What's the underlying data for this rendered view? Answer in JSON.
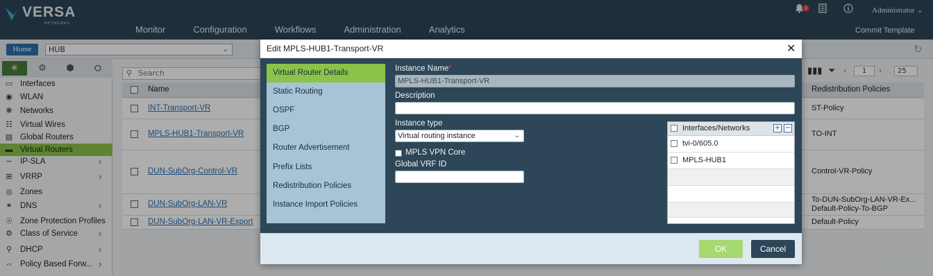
{
  "header": {
    "logo_text": "VERSA",
    "logo_sub": "NETWORKS",
    "nav": [
      "Monitor",
      "Configuration",
      "Workflows",
      "Administration",
      "Analytics"
    ],
    "alerts_badge": "0",
    "user": "Administrator",
    "commit_template": "Commit Template"
  },
  "subbar": {
    "home_label": "Home",
    "hub_value": "HUB"
  },
  "sidebar": {
    "items": [
      {
        "label": "Interfaces",
        "icon": "interfaces-icon"
      },
      {
        "label": "WLAN",
        "icon": "wlan-icon"
      },
      {
        "label": "Networks",
        "icon": "networks-icon"
      },
      {
        "label": "Virtual Wires",
        "icon": "virtual-wires-icon"
      },
      {
        "label": "Global Routers",
        "icon": "global-routers-icon"
      },
      {
        "label": "Virtual Routers",
        "icon": "virtual-routers-icon"
      },
      {
        "label": "IP-SLA",
        "icon": "ip-sla-icon"
      },
      {
        "label": "VRRP",
        "icon": "vrrp-icon"
      },
      {
        "label": "Zones",
        "icon": "zones-icon"
      },
      {
        "label": "DNS",
        "icon": "dns-icon"
      },
      {
        "label": "Zone Protection Profiles",
        "icon": "zone-protection-icon"
      },
      {
        "label": "Class of Service",
        "icon": "class-of-service-icon"
      },
      {
        "label": "DHCP",
        "icon": "dhcp-icon"
      },
      {
        "label": "Policy Based Forw...",
        "icon": "policy-forwarding-icon"
      }
    ]
  },
  "table": {
    "search_placeholder": "Search",
    "headers": {
      "name": "Name",
      "redistribution": "Redistribution Policies"
    },
    "rows": [
      {
        "name": "INT-Transport-VR",
        "redistribution": "ST-Policy"
      },
      {
        "name": "MPLS-HUB1-Transport-VR",
        "redistribution": "TO-INT"
      },
      {
        "name": "DUN-SubOrg-Control-VR",
        "redistribution": "Control-VR-Policy"
      },
      {
        "name": "DUN-SubOrg-LAN-VR",
        "redistribution": "To-DUN-SubOrg-LAN-VR-Ex...",
        "redistribution2": "Default-Policy-To-BGP"
      },
      {
        "name": "DUN-SubOrg-LAN-VR-Export",
        "redistribution": "Default-Policy"
      }
    ],
    "page": "1",
    "page_size": "25"
  },
  "modal": {
    "title": "Edit MPLS-HUB1-Transport-VR",
    "nav": [
      "Virtual Router Details",
      "Static Routing",
      "OSPF",
      "BGP",
      "Router Advertisement",
      "Prefix Lists",
      "Redistribution Policies",
      "Instance Import Policies"
    ],
    "instance_name_label": "Instance Name",
    "instance_name_value": "MPLS-HUB1-Transport-VR",
    "description_label": "Description",
    "instance_type_label": "Instance type",
    "instance_type_value": "Virtual routing instance",
    "mpls_vpn_core_label": "MPLS VPN Core",
    "global_vrf_label": "Global VRF ID",
    "interfaces_header": "Interfaces/Networks",
    "interfaces": [
      "tvi-0/605.0",
      "MPLS-HUB1"
    ],
    "ok_label": "OK",
    "cancel_label": "Cancel"
  },
  "colors": {
    "header_bg": "#2d4658",
    "accent_green": "#8bc34a",
    "link_blue": "#2a6fb0"
  }
}
